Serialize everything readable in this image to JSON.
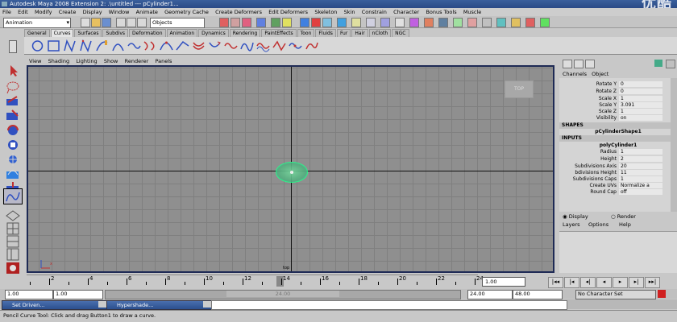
{
  "window": {
    "title": "Autodesk Maya 2008 Extension 2: .\\untitled   ---   pCylinder1...",
    "watermark": "优酷"
  },
  "menu": [
    "File",
    "Edit",
    "Modify",
    "Create",
    "Display",
    "Window",
    "Animate",
    "Geometry Cache",
    "Create Deformers",
    "Edit Deformers",
    "Skeleton",
    "Skin",
    "Constrain",
    "Character",
    "Bonus Tools",
    "Muscle"
  ],
  "statusline": {
    "mode": "Animation",
    "object_field": "Objects"
  },
  "shelf_tabs": [
    "General",
    "Curves",
    "Surfaces",
    "Subdivs",
    "Deformation",
    "Animation",
    "Dynamics",
    "Rendering",
    "PaintEffects",
    "Toon",
    "Fluids",
    "Fur",
    "Hair",
    "nCloth",
    "NGC"
  ],
  "shelf_active": "Curves",
  "viewport": {
    "menu": [
      "View",
      "Shading",
      "Lighting",
      "Show",
      "Renderer",
      "Panels"
    ],
    "camera_label": "TOP",
    "origin_label": "top"
  },
  "channel_box": {
    "tabs": [
      "Channels",
      "Object"
    ],
    "attrs": [
      {
        "label": "Rotate Y",
        "value": "0"
      },
      {
        "label": "Rotate Z",
        "value": "0"
      },
      {
        "label": "Scale X",
        "value": "1"
      },
      {
        "label": "Scale Y",
        "value": "3.091"
      },
      {
        "label": "Scale Z",
        "value": "1"
      },
      {
        "label": "Visibility",
        "value": "on"
      }
    ],
    "shapes_header": "SHAPES",
    "shape_name": "pCylinderShape1",
    "inputs_header": "INPUTS",
    "input_name": "polyCylinder1",
    "inputs": [
      {
        "label": "Radius",
        "value": "1"
      },
      {
        "label": "Height",
        "value": "2"
      },
      {
        "label": "Subdivisions Axis",
        "value": "20"
      },
      {
        "label": "bdivisions Height",
        "value": "11"
      },
      {
        "label": "Subdivisions Caps",
        "value": "1"
      },
      {
        "label": "Create UVs",
        "value": "Normalize a"
      },
      {
        "label": "Round Cap",
        "value": "off"
      }
    ]
  },
  "layer_editor": {
    "display": "Display",
    "render": "Render",
    "menu": [
      "Layers",
      "Options",
      "Help"
    ]
  },
  "time_slider": {
    "labels": [
      "2",
      "4",
      "6",
      "8",
      "10",
      "12",
      "14",
      "16",
      "18",
      "20",
      "22",
      "24"
    ],
    "current_time": "1.00",
    "current_frame": "15"
  },
  "playback": [
    "|◂◂",
    "|◂",
    "◂|",
    "◂",
    "▸",
    "▸|",
    "▸▸|"
  ],
  "range": {
    "start": "1.00",
    "start2": "1.00",
    "range_label": "24.00",
    "end": "24.00",
    "end2": "48.00",
    "character_set": "No Character Set"
  },
  "taskbar": [
    {
      "label": "Set Driven..."
    },
    {
      "label": "Hypershade..."
    }
  ],
  "help_line": "Pencil Curve Tool: Click and drag Button1 to draw a curve."
}
